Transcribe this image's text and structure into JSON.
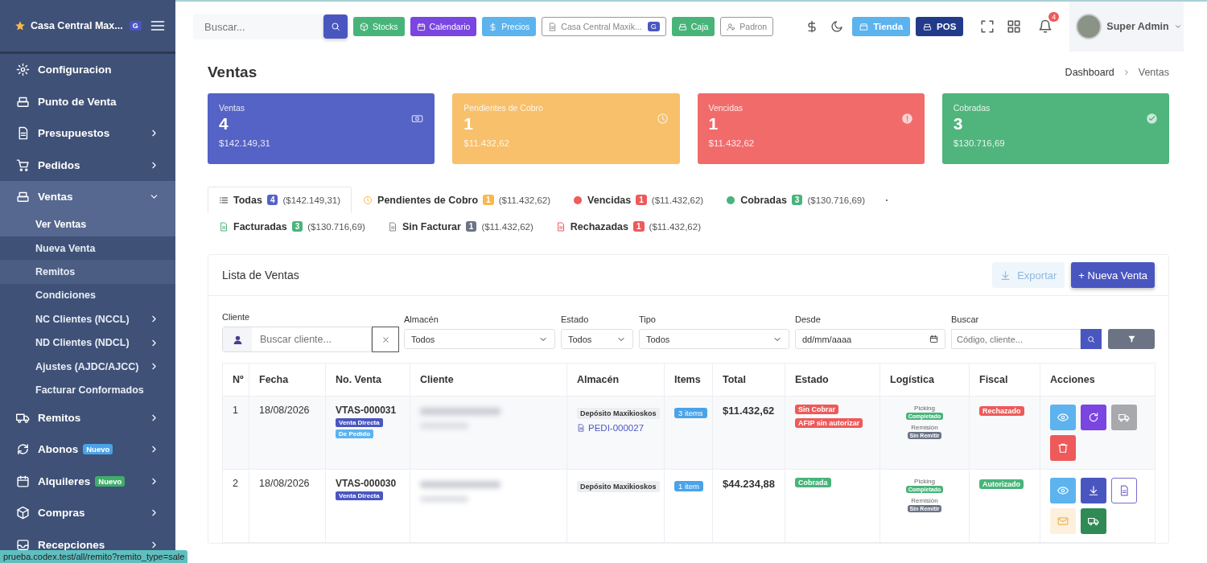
{
  "sidebar": {
    "brand": "Casa Central Max...",
    "brand_badge": "G",
    "items": [
      {
        "label": "Configuracion",
        "arrow": false
      },
      {
        "label": "Punto de Venta",
        "arrow": false
      },
      {
        "label": "Presupuestos",
        "arrow": true,
        "expanded": false
      },
      {
        "label": "Pedidos",
        "arrow": true,
        "expanded": false
      },
      {
        "label": "Ventas",
        "arrow": true,
        "expanded": true,
        "children": [
          {
            "label": "Ver Ventas",
            "selected": true,
            "arrow": false
          },
          {
            "label": "Nueva Venta",
            "selected": false,
            "arrow": false
          },
          {
            "label": "Remitos",
            "selected": false,
            "hovered": true,
            "arrow": false
          },
          {
            "label": "Condiciones",
            "selected": false,
            "arrow": false
          },
          {
            "label": "NC Clientes (NCCL)",
            "selected": false,
            "arrow": true
          },
          {
            "label": "ND Clientes (NDCL)",
            "selected": false,
            "arrow": true
          },
          {
            "label": "Ajustes (AJDC/AJCC)",
            "selected": false,
            "arrow": true
          },
          {
            "label": "Facturar Conformados",
            "selected": false,
            "arrow": false
          }
        ]
      },
      {
        "label": "Remitos",
        "arrow": true,
        "expanded": false
      },
      {
        "label": "Abonos",
        "arrow": true,
        "expanded": false,
        "badge": {
          "label": "Nuevo",
          "color": "#4aa3e8"
        }
      },
      {
        "label": "Alquileres",
        "arrow": true,
        "expanded": false,
        "badge": {
          "label": "Nuevo",
          "color": "#3fae6a"
        }
      },
      {
        "label": "Compras",
        "arrow": true,
        "expanded": false
      },
      {
        "label": "Recepciones",
        "arrow": true,
        "expanded": false
      }
    ]
  },
  "topbar": {
    "search": {
      "placeholder": "Buscar..."
    },
    "buttons": [
      {
        "label": "Stocks",
        "color": "#48b47a",
        "kind": "filled"
      },
      {
        "label": "Calendario",
        "color": "#7a45e0",
        "kind": "filled"
      },
      {
        "label": "Precios",
        "color": "#5cb3ee",
        "kind": "filled"
      },
      {
        "label": "Casa Central Maxik...",
        "badge": "G",
        "kind": "outline"
      },
      {
        "label": "Caja",
        "color": "#48b47a",
        "kind": "filled"
      },
      {
        "label": "Padron",
        "kind": "outline"
      }
    ],
    "right_buttons": [
      {
        "label": "Tienda",
        "color": "#5cb3ee"
      },
      {
        "label": "POS",
        "color": "#223a8a"
      }
    ],
    "notifications": "4",
    "user": "Super Admin"
  },
  "page": {
    "title": "Ventas",
    "breadcrumb": [
      "Dashboard",
      "Ventas"
    ]
  },
  "stats": [
    {
      "label": "Ventas",
      "value": "4",
      "amount": "$142.149,31",
      "color": "#5563c6",
      "kind": "money"
    },
    {
      "label": "Pendientes de Cobro",
      "value": "1",
      "amount": "$11.432,62",
      "color": "#f8c06a",
      "kind": "clock"
    },
    {
      "label": "Vencidas",
      "value": "1",
      "amount": "$11.432,62",
      "color": "#f26b6b",
      "kind": "alert"
    },
    {
      "label": "Cobradas",
      "value": "3",
      "amount": "$130.716,69",
      "color": "#4fb57c",
      "kind": "check"
    }
  ],
  "tabs": [
    {
      "label": "Todas",
      "count": "4",
      "amount": "($142.149,31)",
      "color": "#5563c6",
      "selected": true
    },
    {
      "label": "Pendientes de Cobro",
      "count": "1",
      "amount": "($11.432,62)",
      "color": "#f8b84e",
      "selected": false
    },
    {
      "label": "Vencidas",
      "count": "1",
      "amount": "($11.432,62)",
      "color": "#ee5a5a",
      "selected": false
    },
    {
      "label": "Cobradas",
      "count": "3",
      "amount": "($130.716,69)",
      "color": "#48b47a",
      "selected": false
    },
    {
      "label": "Facturadas",
      "count": "3",
      "amount": "($130.716,69)",
      "color": "#48b47a",
      "selected": false
    },
    {
      "label": "Sin Facturar",
      "count": "1",
      "amount": "($11.432,62)",
      "color": "#6b7385",
      "selected": false
    },
    {
      "label": "Rechazadas",
      "count": "1",
      "amount": "($11.432,62)",
      "color": "#ee5a5a",
      "selected": false
    }
  ],
  "list": {
    "title": "Lista de Ventas",
    "export": "Exportar",
    "new": "+ Nueva Venta",
    "filters": {
      "cliente": {
        "label": "Cliente",
        "placeholder": "Buscar cliente..."
      },
      "almacen": {
        "label": "Almacén",
        "value": "Todos"
      },
      "estado": {
        "label": "Estado",
        "value": "Todos"
      },
      "tipo": {
        "label": "Tipo",
        "value": "Todos"
      },
      "desde": {
        "label": "Desde",
        "value": "dd/mm/aaaa"
      },
      "buscar": {
        "label": "Buscar",
        "placeholder": "Código, cliente..."
      }
    },
    "columns": [
      "Nº",
      "Fecha",
      "No. Venta",
      "Cliente",
      "Almacén",
      "Items",
      "Total",
      "Estado",
      "Logística",
      "Fiscal",
      "Acciones"
    ],
    "rows": [
      {
        "no": "1",
        "fecha": "18/08/2026",
        "venta": "VTAS-000031",
        "tags": [
          {
            "label": "Venta Directa",
            "color": "#4a56c0"
          },
          {
            "label": "De Pedido",
            "color": "#5cb3ee"
          }
        ],
        "almacen": "Depósito Maxikioskos",
        "pedido": "PEDI-000027",
        "items": "3 items",
        "total": "$11.432,62",
        "estado": [
          {
            "label": "Sin Cobrar",
            "color": "#ee5a5a"
          },
          {
            "label": "AFIP sin autorizar",
            "color": "#ee5a5a"
          }
        ],
        "picking_label": "Picking",
        "picking": {
          "label": "Completado",
          "color": "#48b47a"
        },
        "remision_label": "Remisión",
        "remision": {
          "label": "Sin Remitir",
          "color": "#6b7385"
        },
        "fiscal": {
          "label": "Rechazado",
          "color": "#ee5a5a"
        },
        "actions": [
          {
            "kind": "eye",
            "color": "#5cb3ee"
          },
          {
            "kind": "refresh",
            "color": "#7a45e0"
          },
          {
            "kind": "truck",
            "color": "#a7a9ad"
          },
          {
            "kind": "trash",
            "color": "#ee5a5a"
          }
        ]
      },
      {
        "no": "2",
        "fecha": "18/08/2026",
        "venta": "VTAS-000030",
        "tags": [
          {
            "label": "Venta Directa",
            "color": "#4a56c0"
          }
        ],
        "almacen": "Depósito Maxikioskos",
        "items": "1 item",
        "total": "$44.234,88",
        "estado": [
          {
            "label": "Cobrada",
            "color": "#48b47a"
          }
        ],
        "picking_label": "Picking",
        "picking": {
          "label": "Completado",
          "color": "#48b47a"
        },
        "remision_label": "Remisión",
        "remision": {
          "label": "Sin Remitir",
          "color": "#6b7385"
        },
        "fiscal": {
          "label": "Autorizado",
          "color": "#48b47a"
        },
        "actions": [
          {
            "kind": "eye",
            "color": "#5cb3ee"
          },
          {
            "kind": "download",
            "color": "#4a56c0"
          },
          {
            "kind": "document",
            "color": "#ffffff"
          },
          {
            "kind": "mail",
            "color": "#fdf0dc"
          },
          {
            "kind": "truck",
            "color": "#2f8a55"
          }
        ]
      }
    ]
  },
  "status_url": "prueba.codex.test/all/remito?remito_type=sale"
}
